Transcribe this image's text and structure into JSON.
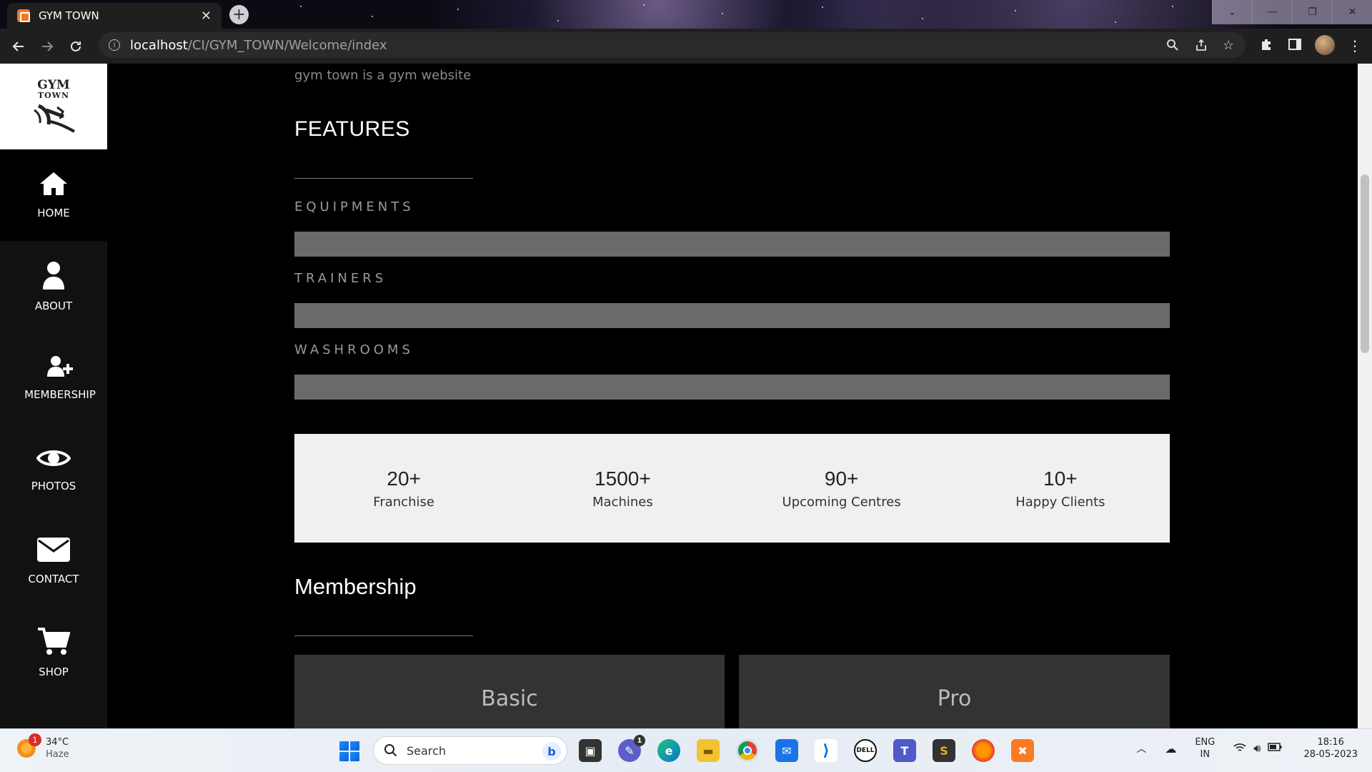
{
  "browser": {
    "tab_title": "GYM TOWN",
    "url_host": "localhost",
    "url_path": "/CI/GYM_TOWN/Welcome/index"
  },
  "sidebar": {
    "logo_line1": "GYM",
    "logo_line2": "TOWN",
    "items": [
      {
        "label": "HOME",
        "icon": "home-icon"
      },
      {
        "label": "ABOUT",
        "icon": "user-icon"
      },
      {
        "label": "MEMBERSHIP",
        "icon": "user-plus-icon"
      },
      {
        "label": "PHOTOS",
        "icon": "eye-icon"
      },
      {
        "label": "CONTACT",
        "icon": "envelope-icon"
      },
      {
        "label": "SHOP",
        "icon": "cart-icon"
      }
    ]
  },
  "main": {
    "tagline": "gym town is a gym website",
    "features_title": "FEATURES",
    "features": [
      {
        "label": "EQUIPMENTS"
      },
      {
        "label": "TRAINERS"
      },
      {
        "label": "WASHROOMS"
      }
    ],
    "stats": [
      {
        "value": "20+",
        "label": "Franchise"
      },
      {
        "value": "1500+",
        "label": "Machines"
      },
      {
        "value": "90+",
        "label": "Upcoming Centres"
      },
      {
        "value": "10+",
        "label": "Happy Clients"
      }
    ],
    "membership_title": "Membership",
    "plans": [
      {
        "name": "Basic"
      },
      {
        "name": "Pro"
      }
    ]
  },
  "taskbar": {
    "weather_temp": "34°C",
    "weather_condition": "Haze",
    "weather_badge": "1",
    "search_placeholder": "Search",
    "chat_badge": "1",
    "language": "ENG",
    "region": "IN",
    "time": "18:16",
    "date": "28-05-2023"
  },
  "colors": {
    "page_background": "#000000",
    "sidebar_background": "#111111",
    "feature_bar": "#6a6a6a",
    "stats_background": "#f0f0f0",
    "plan_card": "#333333"
  }
}
